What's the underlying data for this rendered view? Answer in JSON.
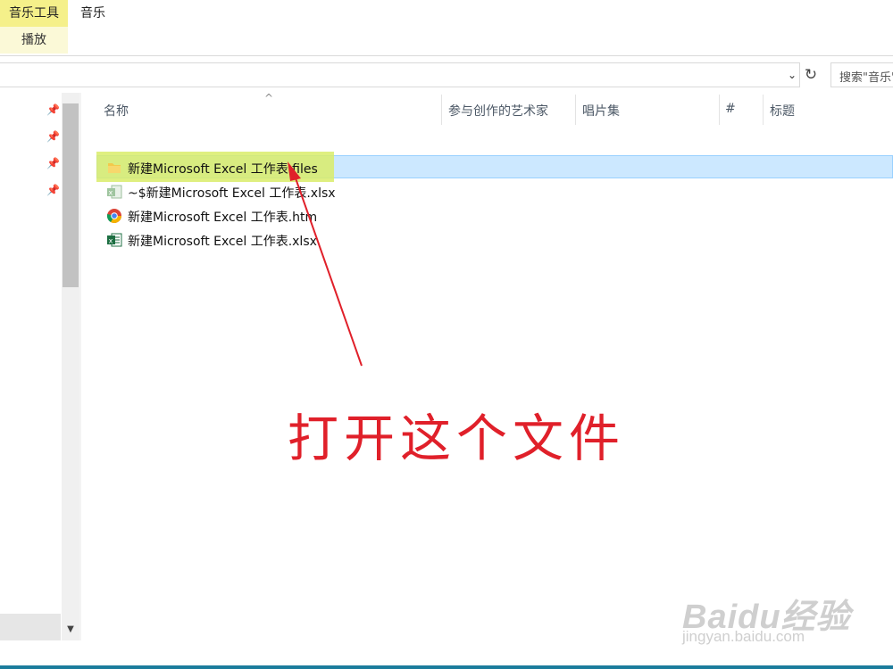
{
  "ribbon": {
    "tool_tab": "音乐工具",
    "tool_sub": "播放",
    "music_tab": "音乐"
  },
  "address": {
    "search_placeholder": "搜索\"音乐\""
  },
  "columns": [
    "名称",
    "参与创作的艺术家",
    "唱片集",
    "#",
    "标题"
  ],
  "files": [
    {
      "name": "新建Microsoft Excel 工作表.files",
      "icon": "folder-icon",
      "selected": true
    },
    {
      "name": "~$新建Microsoft Excel 工作表.xlsx",
      "icon": "excel-temp-icon",
      "selected": false
    },
    {
      "name": "新建Microsoft Excel 工作表.htm",
      "icon": "chrome-icon",
      "selected": false
    },
    {
      "name": "新建Microsoft Excel 工作表.xlsx",
      "icon": "excel-icon",
      "selected": false
    }
  ],
  "annotation": {
    "text": "打开这个文件",
    "color": "#e0202a"
  },
  "watermark": {
    "brand": "Baidu经验",
    "url": "jingyan.baidu.com"
  }
}
